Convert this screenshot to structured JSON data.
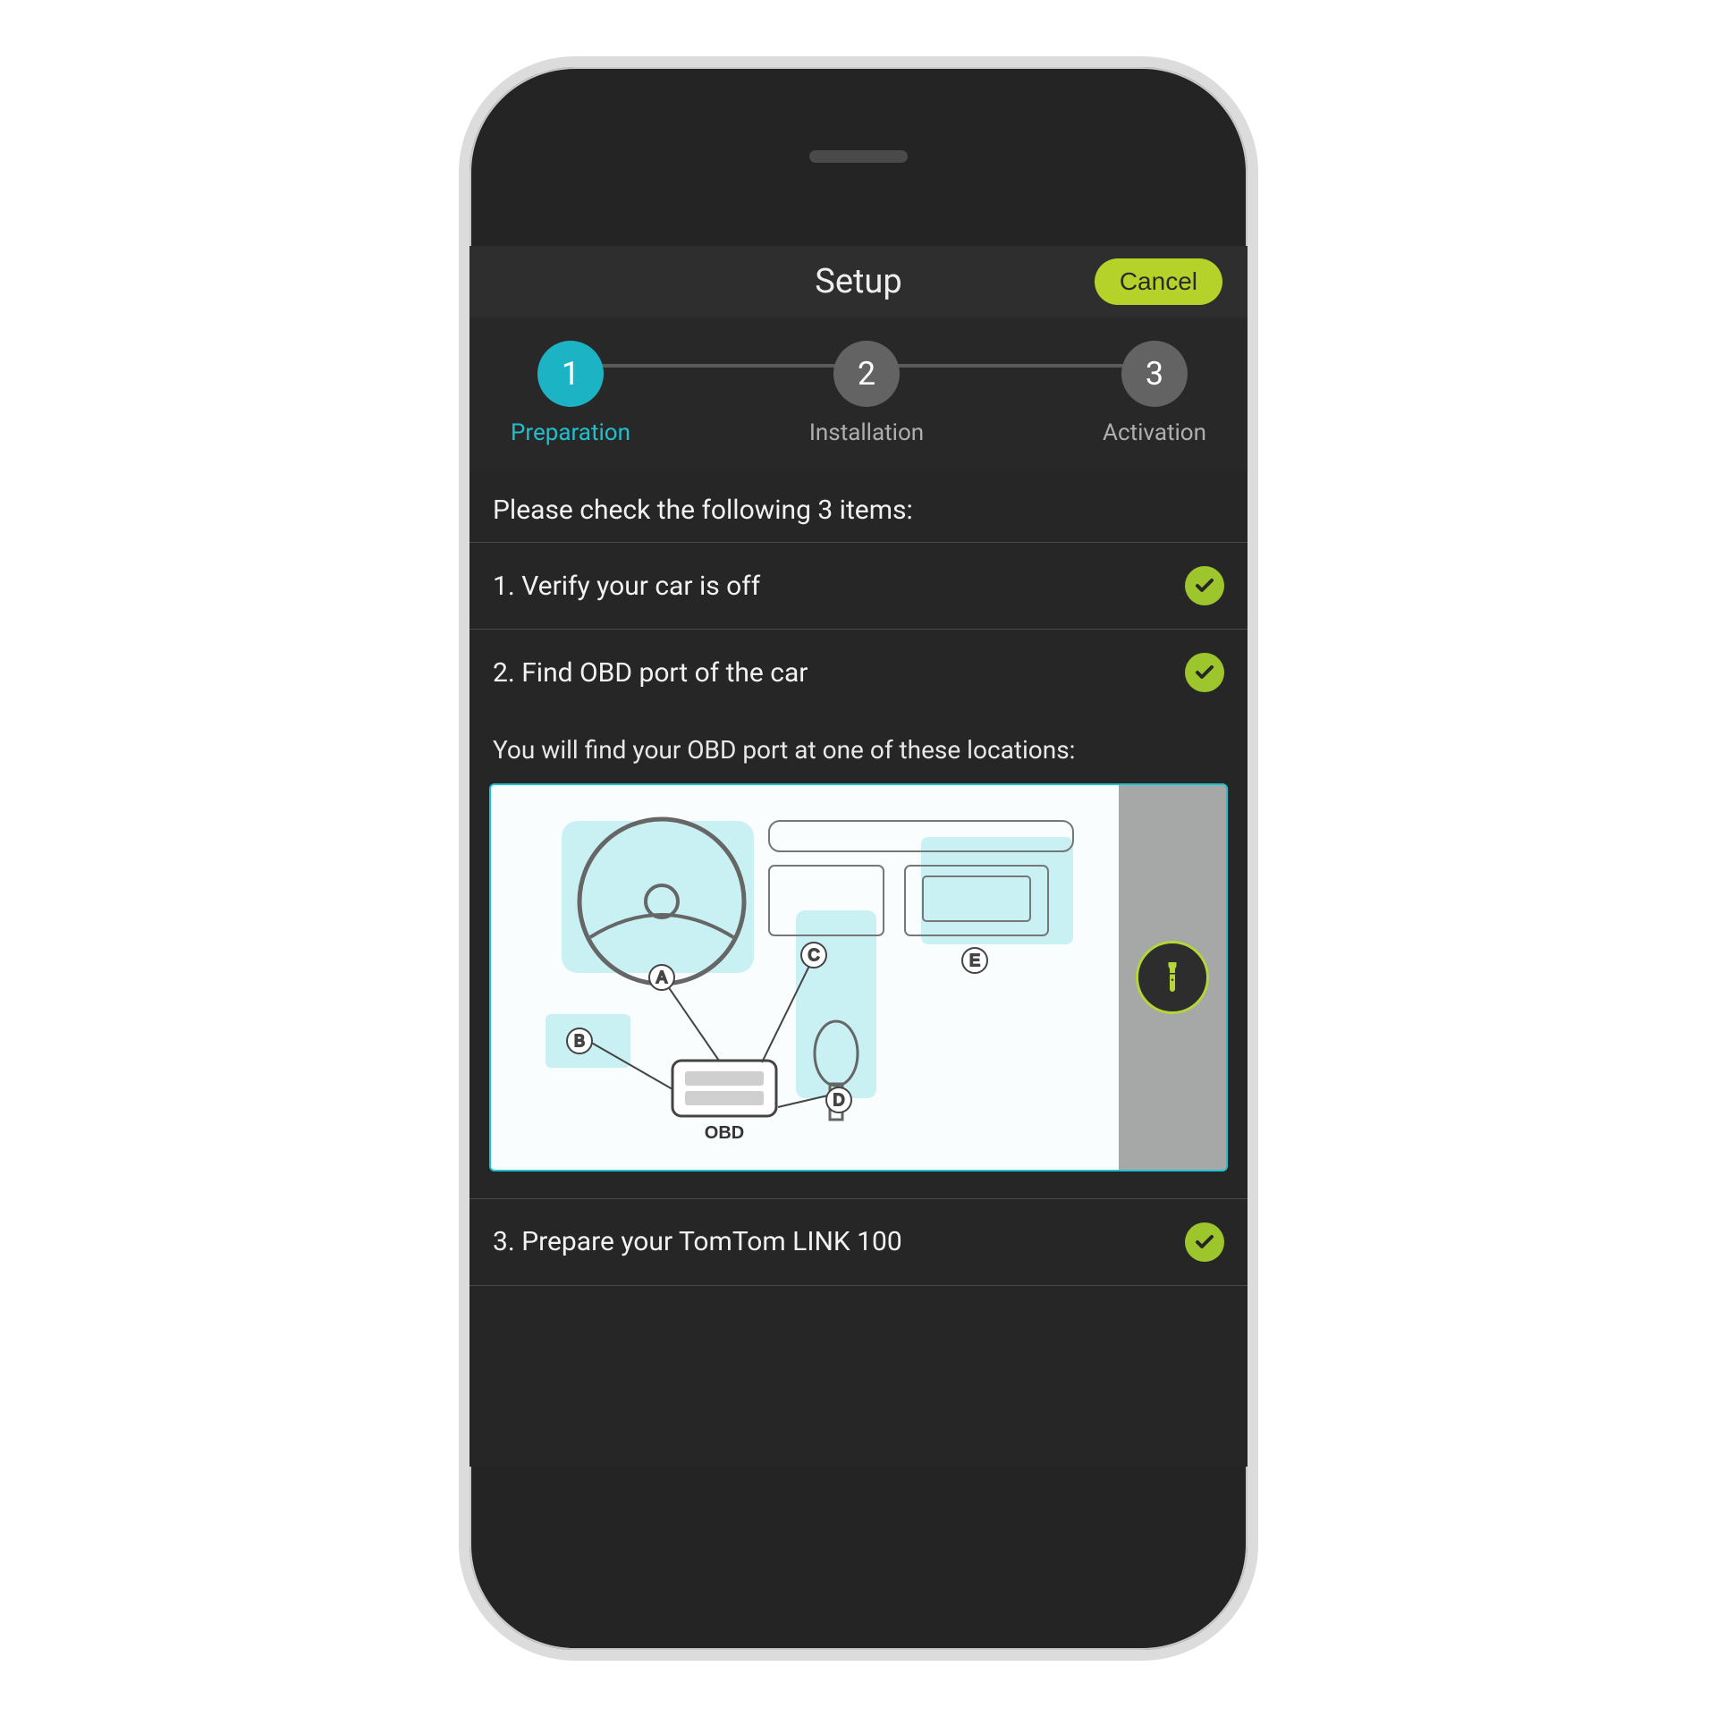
{
  "header": {
    "title": "Setup",
    "cancel_label": "Cancel"
  },
  "steps": [
    {
      "num": "1",
      "label": "Preparation",
      "active": true
    },
    {
      "num": "2",
      "label": "Installation",
      "active": false
    },
    {
      "num": "3",
      "label": "Activation",
      "active": false
    }
  ],
  "instruction": "Please check the following 3 items:",
  "checklist": [
    {
      "text": "1. Verify your car is off",
      "checked": true
    },
    {
      "text": "2. Find OBD port of the car",
      "checked": true
    },
    {
      "text": "3. Prepare your TomTom LINK 100",
      "checked": true
    }
  ],
  "obd_hint": "You will find your OBD port at one of these locations:",
  "diagram": {
    "markers": [
      "A",
      "B",
      "C",
      "D",
      "E"
    ],
    "obd_label": "OBD"
  },
  "colors": {
    "accent": "#b4d22a",
    "progress_active": "#1cb4c4"
  }
}
